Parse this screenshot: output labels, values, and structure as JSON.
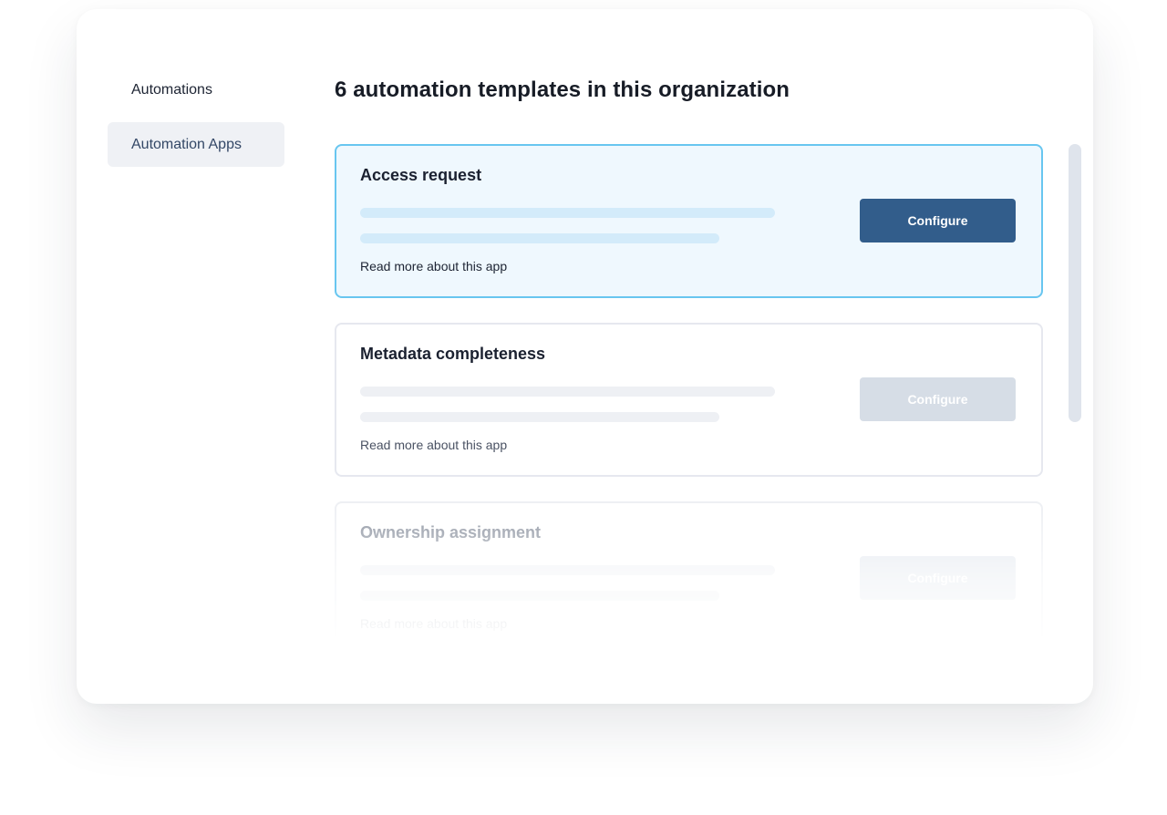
{
  "sidebar": {
    "items": [
      {
        "label": "Automations"
      },
      {
        "label": "Automation Apps"
      }
    ]
  },
  "main": {
    "title": "6 automation templates in this organization",
    "cards": [
      {
        "title": "Access request",
        "link": "Read more about this app",
        "button": "Configure",
        "state": "selected"
      },
      {
        "title": "Metadata completeness",
        "link": "Read more about this app",
        "button": "Configure",
        "state": "disabled"
      },
      {
        "title": "Ownership assignment",
        "link": "Read more about this app",
        "button": "Configure",
        "state": "faded"
      }
    ]
  },
  "colors": {
    "selected_border": "#68c6f0",
    "selected_background": "#eff8fe",
    "primary_button": "#325d8b",
    "disabled_button": "#d6dde6",
    "active_nav_background": "#eff1f5"
  }
}
